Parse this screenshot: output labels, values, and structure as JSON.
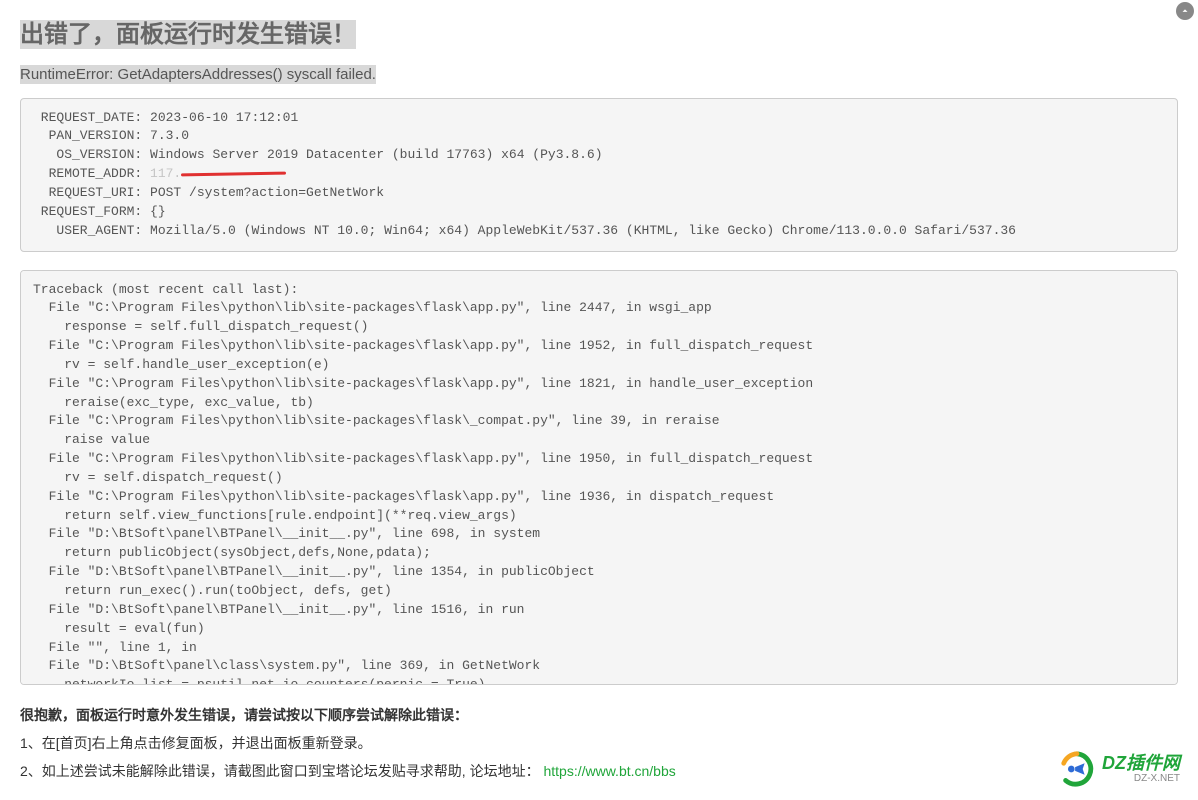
{
  "header": {
    "title": "出错了，面板运行时发生错误！",
    "subtitle": "RuntimeError: GetAdaptersAddresses() syscall failed."
  },
  "request_info": {
    "request_date_label": " REQUEST_DATE: ",
    "request_date": "2023-06-10 17:12:01",
    "pan_version_label": "  PAN_VERSION: ",
    "pan_version": "7.3.0",
    "os_version_label": "   OS_VERSION: ",
    "os_version": "Windows Server 2019 Datacenter (build 17763) x64 (Py3.8.6)",
    "remote_addr_label": "  REMOTE_ADDR: ",
    "remote_addr_prefix": "117.",
    "request_uri_label": "  REQUEST_URI: ",
    "request_uri": "POST /system?action=GetNetWork",
    "request_form_label": " REQUEST_FORM: ",
    "request_form": "{}",
    "user_agent_label": "   USER_AGENT: ",
    "user_agent": "Mozilla/5.0 (Windows NT 10.0; Win64; x64) AppleWebKit/537.36 (KHTML, like Gecko) Chrome/113.0.0.0 Safari/537.36"
  },
  "traceback": "Traceback (most recent call last):\n  File \"C:\\Program Files\\python\\lib\\site-packages\\flask\\app.py\", line 2447, in wsgi_app\n    response = self.full_dispatch_request()\n  File \"C:\\Program Files\\python\\lib\\site-packages\\flask\\app.py\", line 1952, in full_dispatch_request\n    rv = self.handle_user_exception(e)\n  File \"C:\\Program Files\\python\\lib\\site-packages\\flask\\app.py\", line 1821, in handle_user_exception\n    reraise(exc_type, exc_value, tb)\n  File \"C:\\Program Files\\python\\lib\\site-packages\\flask\\_compat.py\", line 39, in reraise\n    raise value\n  File \"C:\\Program Files\\python\\lib\\site-packages\\flask\\app.py\", line 1950, in full_dispatch_request\n    rv = self.dispatch_request()\n  File \"C:\\Program Files\\python\\lib\\site-packages\\flask\\app.py\", line 1936, in dispatch_request\n    return self.view_functions[rule.endpoint](**req.view_args)\n  File \"D:\\BtSoft\\panel\\BTPanel\\__init__.py\", line 698, in system\n    return publicObject(sysObject,defs,None,pdata);\n  File \"D:\\BtSoft\\panel\\BTPanel\\__init__.py\", line 1354, in publicObject\n    return run_exec().run(toObject, defs, get)\n  File \"D:\\BtSoft\\panel\\BTPanel\\__init__.py\", line 1516, in run\n    result = eval(fun)\n  File \"\", line 1, in \n  File \"D:\\BtSoft\\panel\\class\\system.py\", line 369, in GetNetWork\n    networkIo_list = psutil.net_io_counters(pernic = True)\n  ",
  "help": {
    "apology": "很抱歉，面板运行时意外发生错误，请尝试按以下顺序尝试解除此错误：",
    "step1": "1、在[首页]右上角点击修复面板，并退出面板重新登录。",
    "step2_prefix": "2、如上述尝试未能解除此错误，请截图此窗口到宝塔论坛发贴寻求帮助, 论坛地址：",
    "forum_url": "https://www.bt.cn/bbs"
  },
  "watermark": {
    "text": "DZ插件网",
    "sub": "DZ-X.NET"
  }
}
